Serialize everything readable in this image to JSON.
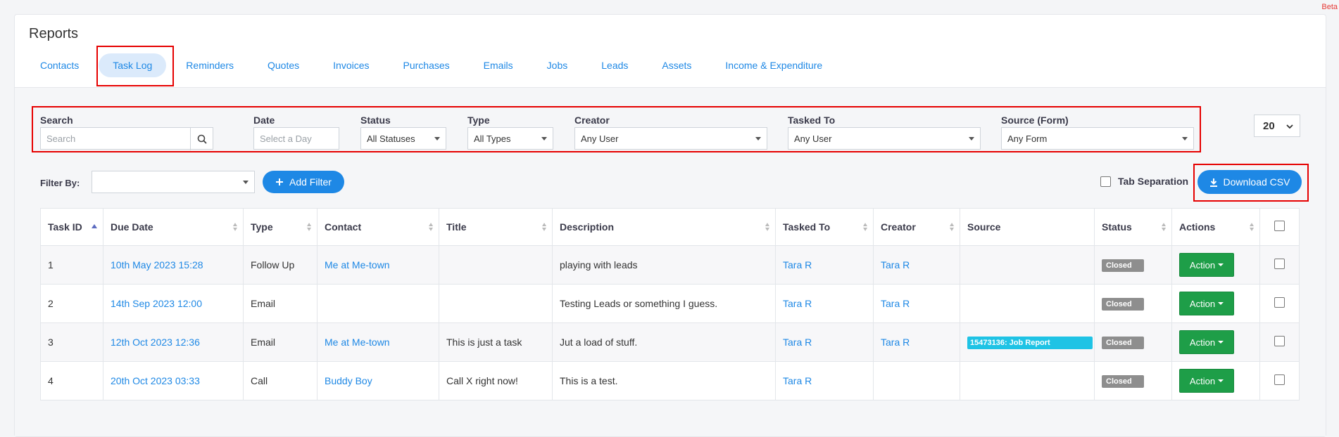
{
  "beta": "Beta",
  "page_title": "Reports",
  "tabs": [
    "Contacts",
    "Task Log",
    "Reminders",
    "Quotes",
    "Invoices",
    "Purchases",
    "Emails",
    "Jobs",
    "Leads",
    "Assets",
    "Income & Expenditure"
  ],
  "active_tab": "Task Log",
  "filters": {
    "search": {
      "label": "Search",
      "placeholder": "Search"
    },
    "date": {
      "label": "Date",
      "placeholder": "Select a Day"
    },
    "status": {
      "label": "Status",
      "value": "All Statuses"
    },
    "type": {
      "label": "Type",
      "value": "All Types"
    },
    "creator": {
      "label": "Creator",
      "value": "Any User"
    },
    "tasked_to": {
      "label": "Tasked To",
      "value": "Any User"
    },
    "source": {
      "label": "Source (Form)",
      "value": "Any Form"
    }
  },
  "per_page": "20",
  "filter_by": {
    "label": "Filter By:",
    "value": ""
  },
  "add_filter_label": "Add Filter",
  "tab_separation_label": "Tab Separation",
  "download_csv_label": "Download CSV",
  "table": {
    "columns": [
      "Task ID",
      "Due Date",
      "Type",
      "Contact",
      "Title",
      "Description",
      "Tasked To",
      "Creator",
      "Source",
      "Status",
      "Actions"
    ],
    "rows": [
      {
        "id": "1",
        "due": "10th May 2023 15:28",
        "type": "Follow Up",
        "contact": "Me at Me-town",
        "title": "",
        "description": "playing with leads",
        "tasked_to": "Tara R",
        "creator": "Tara R",
        "source": "",
        "status": "Closed",
        "action": "Action"
      },
      {
        "id": "2",
        "due": "14th Sep 2023 12:00",
        "type": "Email",
        "contact": "",
        "title": "",
        "description": "Testing Leads or something I guess.",
        "tasked_to": "Tara R",
        "creator": "Tara R",
        "source": "",
        "status": "Closed",
        "action": "Action"
      },
      {
        "id": "3",
        "due": "12th Oct 2023 12:36",
        "type": "Email",
        "contact": "Me at Me-town",
        "title": "This is just a task",
        "description": "Jut a load of stuff.",
        "tasked_to": "Tara R",
        "creator": "Tara R",
        "source": "15473136: Job Report",
        "status": "Closed",
        "action": "Action"
      },
      {
        "id": "4",
        "due": "20th Oct 2023 03:33",
        "type": "Call",
        "contact": "Buddy Boy",
        "title": "Call X right now!",
        "description": "This is a test.",
        "tasked_to": "Tara R",
        "creator": "",
        "source": "",
        "status": "Closed",
        "action": "Action"
      }
    ]
  },
  "colors": {
    "accent": "#1e88e5",
    "action_green": "#1e9e48",
    "status_grey": "#8e8e8e",
    "source_cyan": "#1fc3e5",
    "highlight_red": "#e60000"
  }
}
